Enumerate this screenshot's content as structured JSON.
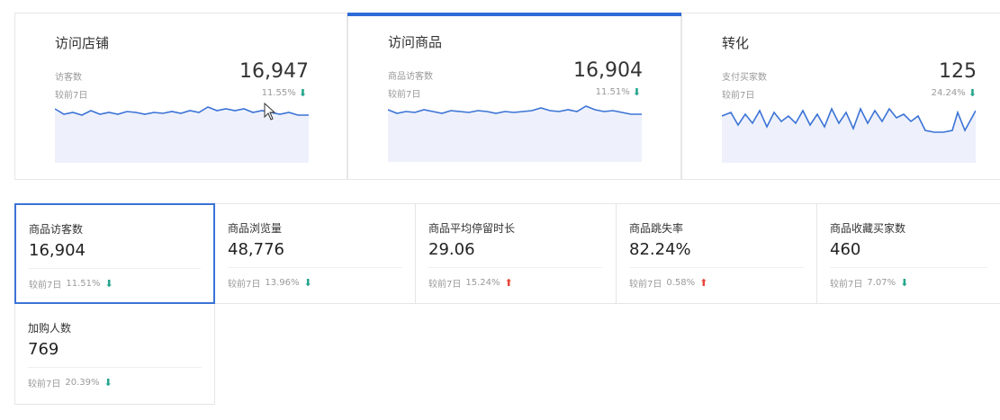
{
  "top_cards": [
    {
      "title": "访问店铺",
      "label": "访客数",
      "compare": "较前7日",
      "value": "16,947",
      "pct": "11.55%",
      "trend": "down"
    },
    {
      "title": "访问商品",
      "label": "商品访客数",
      "compare": "较前7日",
      "value": "16,904",
      "pct": "11.51%",
      "trend": "down"
    },
    {
      "title": "转化",
      "label": "支付买家数",
      "compare": "较前7日",
      "value": "125",
      "pct": "24.24%",
      "trend": "down"
    }
  ],
  "metrics": [
    {
      "label": "商品访客数",
      "value": "16,904",
      "compare": "较前7日",
      "pct": "11.51%",
      "trend": "down"
    },
    {
      "label": "商品浏览量",
      "value": "48,776",
      "compare": "较前7日",
      "pct": "13.96%",
      "trend": "down"
    },
    {
      "label": "商品平均停留时长",
      "value": "29.06",
      "compare": "较前7日",
      "pct": "15.24%",
      "trend": "up"
    },
    {
      "label": "商品跳失率",
      "value": "82.24%",
      "compare": "较前7日",
      "pct": "0.58%",
      "trend": "up"
    },
    {
      "label": "商品收藏买家数",
      "value": "460",
      "compare": "较前7日",
      "pct": "7.07%",
      "trend": "down"
    },
    {
      "label": "加购人数",
      "value": "769",
      "compare": "较前7日",
      "pct": "20.39%",
      "trend": "down"
    }
  ],
  "colors": {
    "accent": "#2f6bd6",
    "down": "#24a58c",
    "up": "#e8463b",
    "spark_fill": "#eef1fb"
  }
}
